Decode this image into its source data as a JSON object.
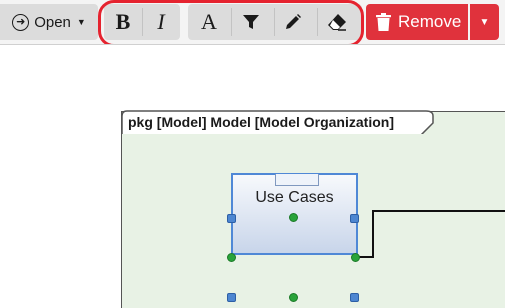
{
  "toolbar": {
    "open_label": "Open",
    "open_icon": "circle-arrow-right-icon",
    "bold_glyph": "B",
    "italic_glyph": "I",
    "font_color_glyph": "A",
    "filter_icon": "filter-icon",
    "pencil_icon": "pencil-icon",
    "eraser_icon": "eraser-icon",
    "remove_label": "Remove",
    "remove_icon": "trash-icon",
    "highlight_color": "#e5232f",
    "remove_color": "#e0323c"
  },
  "diagram": {
    "package_title": "pkg [Model] Model [Model Organization]",
    "package_fill": "#e8f2e5",
    "use_case_label": "Use Cases",
    "selection_color": "#4f88d6",
    "handle_mid_color": "#29a33a"
  }
}
